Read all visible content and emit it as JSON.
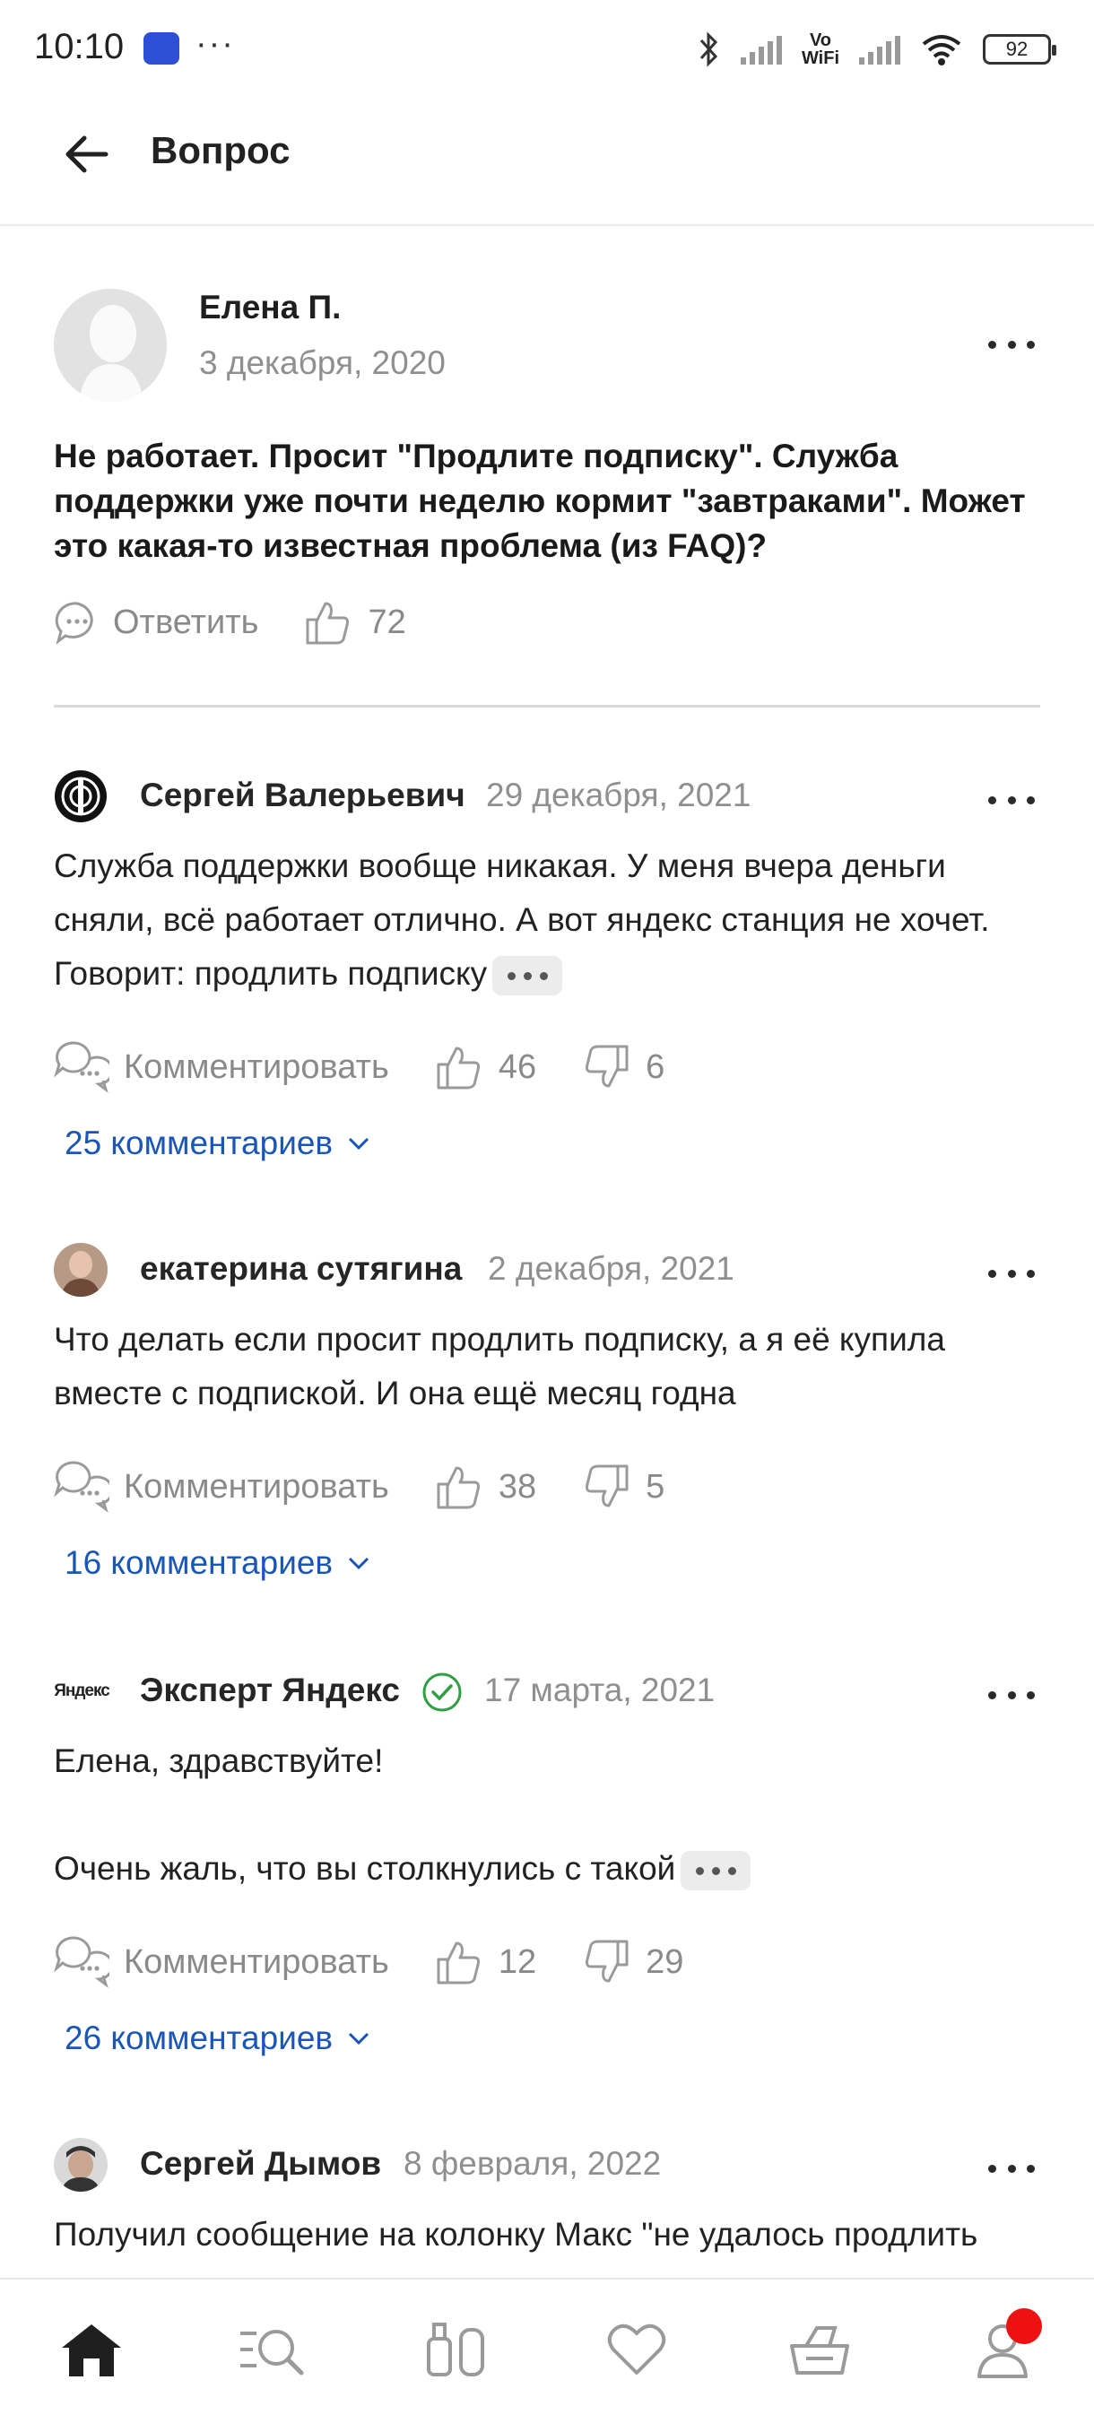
{
  "status_bar": {
    "time": "10:10",
    "dots": "···",
    "vowifi_top": "Vo",
    "vowifi_bottom": "WiFi",
    "battery": "92"
  },
  "header": {
    "title": "Вопрос"
  },
  "question": {
    "author": "Елена П.",
    "date": "3 декабря, 2020",
    "text": "Не работает. Просит \"Продлите подписку\". Служба поддержки уже почти неделю кормит \"завтраками\". Может это какая-то известная проблема (из FAQ)?",
    "reply_label": "Ответить",
    "likes": "72"
  },
  "answers": [
    {
      "author": "Сергей Валерьевич",
      "date": "29 декабря, 2021",
      "text": "Служба поддержки вообще никакая. У меня вчера деньги сняли, всё работает отлично. А вот яндекс станция не хочет. Говорит: продлить подписку",
      "comment_label": "Комментировать",
      "likes": "46",
      "dislikes": "6",
      "comments": "25 комментариев"
    },
    {
      "author": "екатерина сутягина",
      "date": "2 декабря, 2021",
      "text": "Что делать если просит продлить подписку, а я её купила вместе с подпиской.  И она ещё месяц годна",
      "comment_label": "Комментировать",
      "likes": "38",
      "dislikes": "5",
      "comments": "16 комментариев"
    },
    {
      "author": "Эксперт Яндекс",
      "avatar_text": "Яндекс",
      "date": "17 марта, 2021",
      "text_line1": "Елена, здравствуйте!",
      "text_line2": "Очень жаль, что вы столкнулись с такой",
      "comment_label": "Комментировать",
      "likes": "12",
      "dislikes": "29",
      "comments": "26 комментариев"
    },
    {
      "author": "Сергей Дымов",
      "date": "8 февраля, 2022",
      "text": "Получил сообщение на колонку Макс \"не удалось продлить"
    }
  ],
  "colors": {
    "link": "#1a56b8",
    "verified": "#2ea043",
    "badge": "#ee1111",
    "muted": "#8f8f8f"
  },
  "nav": {
    "items": [
      "home-icon",
      "catalog-search-icon",
      "compare-icon",
      "favorites-icon",
      "cart-icon",
      "profile-icon"
    ]
  }
}
